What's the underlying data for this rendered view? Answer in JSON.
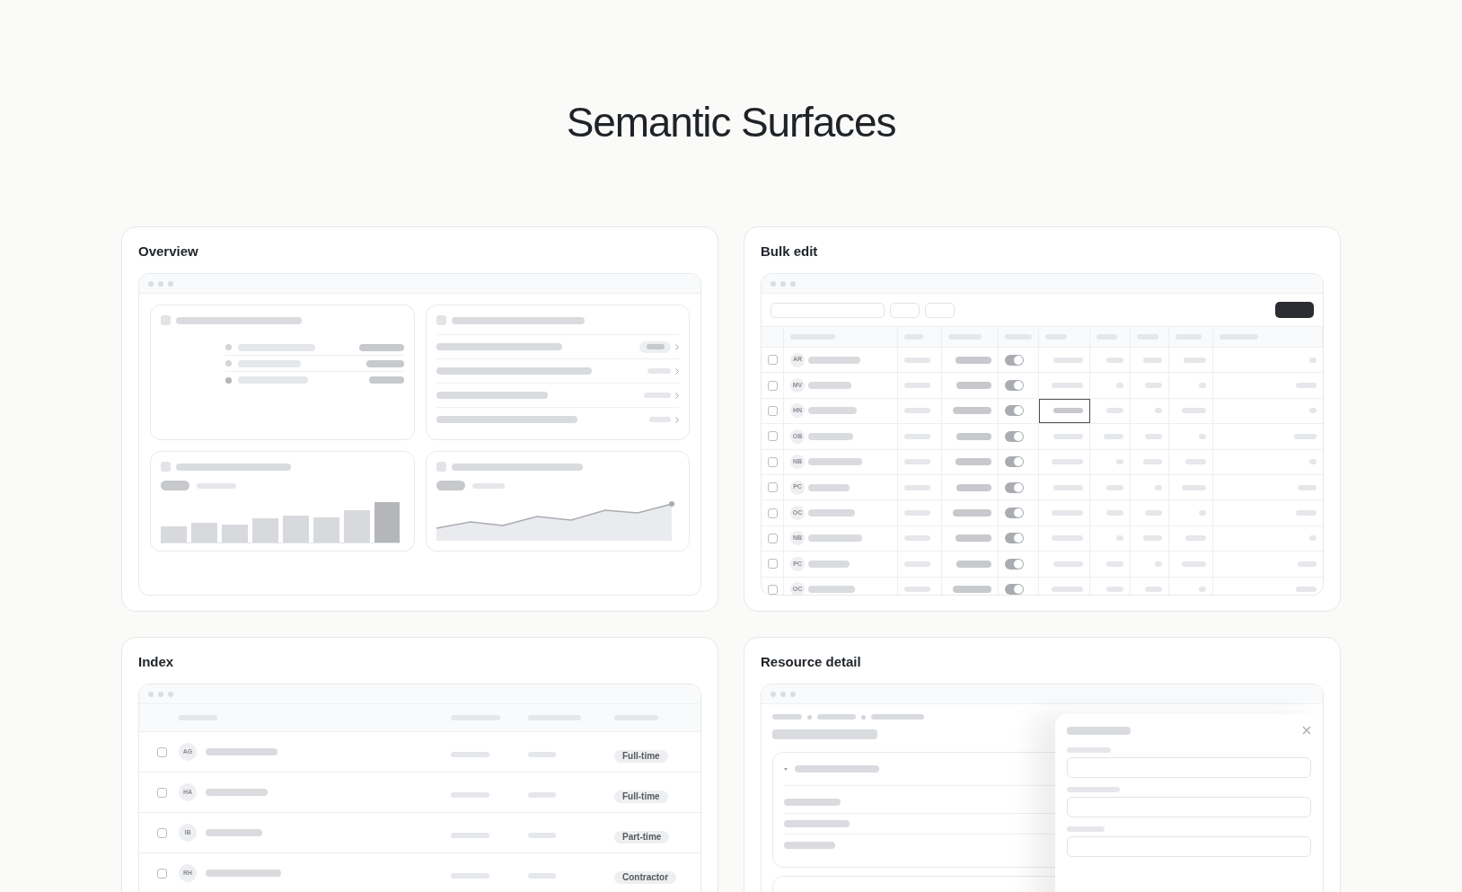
{
  "title": "Semantic Surfaces",
  "overview": {
    "title": "Overview"
  },
  "bulk_edit": {
    "title": "Bulk edit",
    "rows": [
      {
        "initials": "AR",
        "checked": false,
        "on": true,
        "selected": false
      },
      {
        "initials": "MV",
        "checked": false,
        "on": true,
        "selected": false
      },
      {
        "initials": "HN",
        "checked": false,
        "on": true,
        "selected": true
      },
      {
        "initials": "OB",
        "checked": false,
        "on": true,
        "selected": false
      },
      {
        "initials": "NB",
        "checked": false,
        "on": true,
        "selected": false
      },
      {
        "initials": "PC",
        "checked": false,
        "on": true,
        "selected": false
      },
      {
        "initials": "OC",
        "checked": false,
        "on": true,
        "selected": false
      },
      {
        "initials": "NB",
        "checked": false,
        "on": true,
        "selected": false
      },
      {
        "initials": "PC",
        "checked": false,
        "on": true,
        "selected": false
      },
      {
        "initials": "OC",
        "checked": false,
        "on": true,
        "selected": false
      }
    ]
  },
  "index": {
    "title": "Index",
    "rows": [
      {
        "initials": "AG",
        "checked": false,
        "tag": "Full-time"
      },
      {
        "initials": "HA",
        "checked": false,
        "tag": "Full-time"
      },
      {
        "initials": "IB",
        "checked": false,
        "tag": "Part-time"
      },
      {
        "initials": "RH",
        "checked": false,
        "tag": "Contractor"
      }
    ]
  },
  "resource_detail": {
    "title": "Resource detail"
  }
}
